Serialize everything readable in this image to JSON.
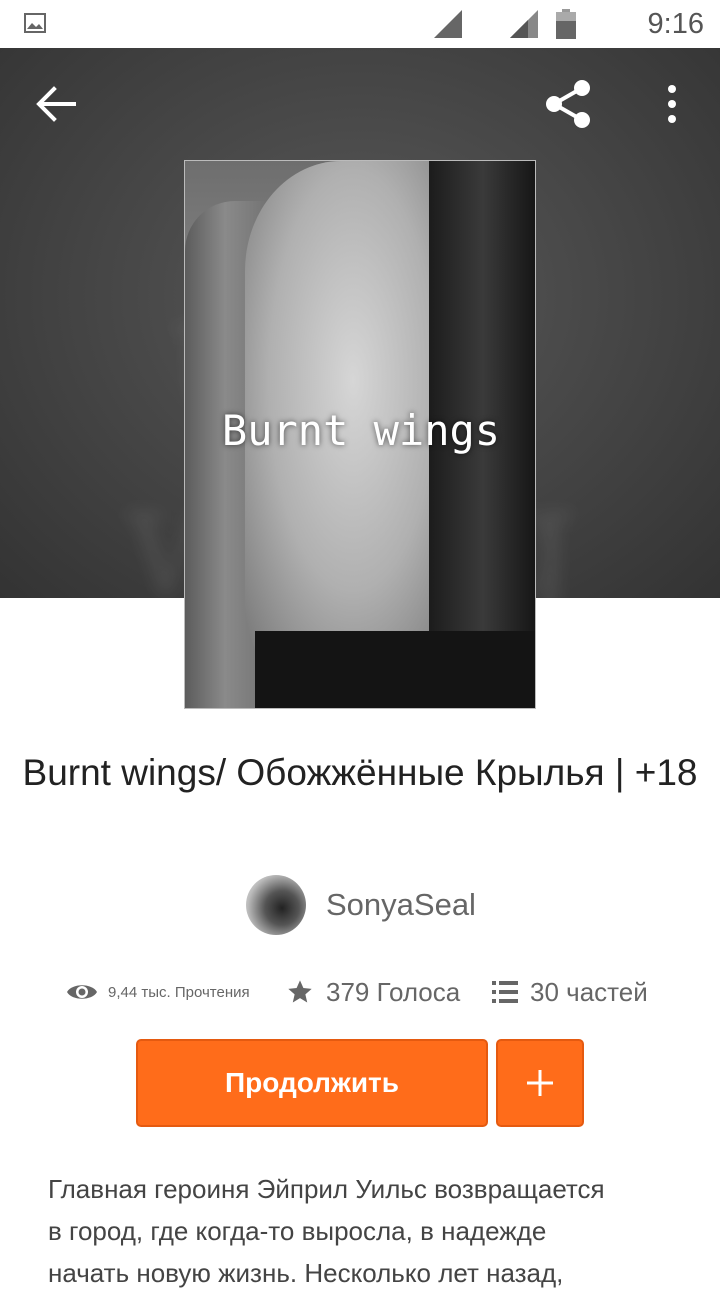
{
  "status_bar": {
    "time": "9:16",
    "icons": [
      "image-notification-icon",
      "signal-icon",
      "signal-icon",
      "battery-icon"
    ]
  },
  "header": {
    "back_icon": "arrow-left-icon",
    "share_icon": "share-icon",
    "more_icon": "more-vert-icon"
  },
  "cover": {
    "title_text": "Burnt wings"
  },
  "book": {
    "title": "Burnt wings/ Обожжённые Крылья | +18",
    "author": "SonyaSeal"
  },
  "stats": {
    "reads": "9,44 тыс. Прочтения",
    "votes": "379 Голоса",
    "parts": "30 частей"
  },
  "actions": {
    "continue_label": "Продолжить",
    "add_label": "+"
  },
  "description": {
    "lines": [
      "Главная героиня Эйприл Уильс  возвращается",
      "в город, где когда-то выросла, в надежде",
      "начать новую жизнь. Несколько лет назад,"
    ]
  },
  "colors": {
    "accent": "#ff6c1a",
    "hero_bg": "#4a4a4a",
    "text_primary": "#222222",
    "text_secondary": "#666666"
  }
}
